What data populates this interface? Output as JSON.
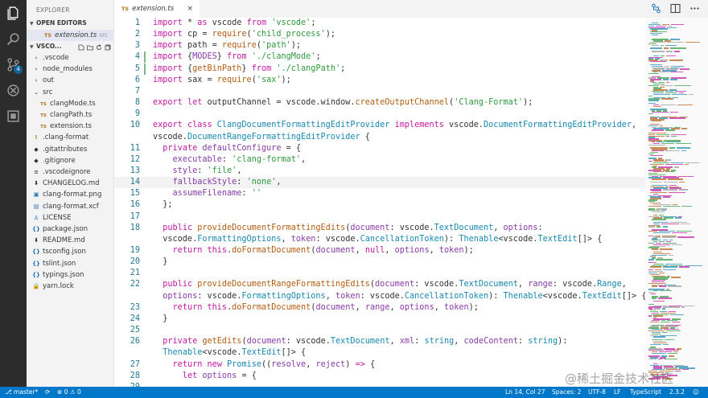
{
  "sidebar": {
    "title": "EXPLORER",
    "open_editors_label": "OPEN EDITORS",
    "open_editor": {
      "badge": "TS",
      "name": "extension.ts",
      "path": "src"
    },
    "project_label": "VSCO...",
    "tree": [
      {
        "label": ".vscode",
        "kind": "folder-closed",
        "indent": 1
      },
      {
        "label": "node_modules",
        "kind": "folder-closed",
        "indent": 1
      },
      {
        "label": "out",
        "kind": "folder-closed",
        "indent": 1
      },
      {
        "label": "src",
        "kind": "folder-open",
        "indent": 1
      },
      {
        "label": "clangMode.ts",
        "kind": "ts",
        "indent": 2
      },
      {
        "label": "clangPath.ts",
        "kind": "ts",
        "indent": 2
      },
      {
        "label": "extension.ts",
        "kind": "ts",
        "indent": 2
      },
      {
        "label": ".clang-format",
        "kind": "excl",
        "indent": 1
      },
      {
        "label": ".gitattributes",
        "kind": "git",
        "indent": 1
      },
      {
        "label": ".gitignore",
        "kind": "git",
        "indent": 1
      },
      {
        "label": ".vscodeignore",
        "kind": "lines",
        "indent": 1
      },
      {
        "label": "CHANGELOG.md",
        "kind": "down",
        "indent": 1
      },
      {
        "label": "clang-format.png",
        "kind": "img",
        "indent": 1
      },
      {
        "label": "clang-format.xcf",
        "kind": "file",
        "indent": 1
      },
      {
        "label": "LICENSE",
        "kind": "license",
        "indent": 1
      },
      {
        "label": "package.json",
        "kind": "json",
        "indent": 1
      },
      {
        "label": "README.md",
        "kind": "down",
        "indent": 1
      },
      {
        "label": "tsconfig.json",
        "kind": "json",
        "indent": 1
      },
      {
        "label": "tslint.json",
        "kind": "json",
        "indent": 1
      },
      {
        "label": "typings.json",
        "kind": "json",
        "indent": 1
      },
      {
        "label": "yarn.lock",
        "kind": "lock",
        "indent": 1
      }
    ]
  },
  "activity": {
    "scm_badge": "4"
  },
  "tab": {
    "badge": "TS",
    "name": "extension.ts",
    "close": "×"
  },
  "editor": {
    "current_line": 14,
    "lines": [
      {
        "n": "1",
        "mod": false,
        "tokens": [
          [
            "k",
            "import "
          ],
          [
            "m",
            "* "
          ],
          [
            "k",
            "as "
          ],
          [
            "m",
            "vscode "
          ],
          [
            "k",
            "from "
          ],
          [
            "s",
            "'vscode'"
          ],
          [
            "m",
            ";"
          ]
        ]
      },
      {
        "n": "2",
        "mod": false,
        "tokens": [
          [
            "k",
            "import "
          ],
          [
            "m",
            "cp = "
          ],
          [
            "f",
            "require"
          ],
          [
            "m",
            "("
          ],
          [
            "s",
            "'child_process'"
          ],
          [
            "m",
            ");"
          ]
        ]
      },
      {
        "n": "3",
        "mod": false,
        "tokens": [
          [
            "k",
            "import "
          ],
          [
            "m",
            "path = "
          ],
          [
            "f",
            "require"
          ],
          [
            "m",
            "("
          ],
          [
            "s",
            "'path'"
          ],
          [
            "m",
            ");"
          ]
        ]
      },
      {
        "n": "4",
        "mod": true,
        "tokens": [
          [
            "k",
            "import "
          ],
          [
            "m",
            "{"
          ],
          [
            "p",
            "MODES"
          ],
          [
            "m",
            "} "
          ],
          [
            "k",
            "from "
          ],
          [
            "s",
            "'./clangMode'"
          ],
          [
            "m",
            ";"
          ]
        ]
      },
      {
        "n": "5",
        "mod": true,
        "tokens": [
          [
            "k",
            "import "
          ],
          [
            "m",
            "{"
          ],
          [
            "f",
            "getBinPath"
          ],
          [
            "m",
            "} "
          ],
          [
            "k",
            "from "
          ],
          [
            "s",
            "'./clangPath'"
          ],
          [
            "m",
            ";"
          ]
        ]
      },
      {
        "n": "6",
        "mod": false,
        "tokens": [
          [
            "k",
            "import "
          ],
          [
            "m",
            "sax = "
          ],
          [
            "f",
            "require"
          ],
          [
            "m",
            "("
          ],
          [
            "s",
            "'sax'"
          ],
          [
            "m",
            ");"
          ]
        ]
      },
      {
        "n": "7",
        "mod": false,
        "tokens": []
      },
      {
        "n": "8",
        "mod": false,
        "tokens": [
          [
            "k",
            "export "
          ],
          [
            "k",
            "let "
          ],
          [
            "m",
            "outputChannel = vscode.window."
          ],
          [
            "f",
            "createOutputChannel"
          ],
          [
            "m",
            "("
          ],
          [
            "s",
            "'Clang-Format'"
          ],
          [
            "m",
            ");"
          ]
        ]
      },
      {
        "n": "9",
        "mod": false,
        "tokens": []
      },
      {
        "n": "10",
        "mod": false,
        "tokens": [
          [
            "k",
            "export "
          ],
          [
            "k",
            "class "
          ],
          [
            "t",
            "ClangDocumentFormattingEditProvider "
          ],
          [
            "k",
            "implements "
          ],
          [
            "m",
            "vscode."
          ],
          [
            "t",
            "DocumentFormattingEditProvider"
          ],
          [
            "m",
            ","
          ]
        ]
      },
      {
        "n": "",
        "mod": false,
        "tokens": [
          [
            "m",
            "vscode."
          ],
          [
            "t",
            "DocumentRangeFormattingEditProvider "
          ],
          [
            "m",
            "{"
          ]
        ]
      },
      {
        "n": "11",
        "mod": false,
        "tokens": [
          [
            "m",
            "  "
          ],
          [
            "k",
            "private "
          ],
          [
            "p",
            "defaultConfigure "
          ],
          [
            "m",
            "= {"
          ]
        ]
      },
      {
        "n": "12",
        "mod": false,
        "tokens": [
          [
            "m",
            "    "
          ],
          [
            "p",
            "executable"
          ],
          [
            "m",
            ": "
          ],
          [
            "s",
            "'clang-format'"
          ],
          [
            "m",
            ","
          ]
        ]
      },
      {
        "n": "13",
        "mod": false,
        "tokens": [
          [
            "m",
            "    "
          ],
          [
            "p",
            "style"
          ],
          [
            "m",
            ": "
          ],
          [
            "s",
            "'file'"
          ],
          [
            "m",
            ","
          ]
        ]
      },
      {
        "n": "14",
        "mod": false,
        "tokens": [
          [
            "m",
            "    "
          ],
          [
            "p",
            "fallbackStyle"
          ],
          [
            "m",
            ": "
          ],
          [
            "s",
            "'none'"
          ],
          [
            "m",
            ","
          ]
        ]
      },
      {
        "n": "15",
        "mod": false,
        "tokens": [
          [
            "m",
            "    "
          ],
          [
            "p",
            "assumeFilename"
          ],
          [
            "m",
            ": "
          ],
          [
            "s",
            "''"
          ]
        ]
      },
      {
        "n": "16",
        "mod": false,
        "tokens": [
          [
            "m",
            "  };"
          ]
        ]
      },
      {
        "n": "17",
        "mod": false,
        "tokens": []
      },
      {
        "n": "18",
        "mod": false,
        "tokens": [
          [
            "m",
            "  "
          ],
          [
            "k",
            "public "
          ],
          [
            "f",
            "provideDocumentFormattingEdits"
          ],
          [
            "m",
            "("
          ],
          [
            "p",
            "document"
          ],
          [
            "m",
            ": vscode."
          ],
          [
            "t",
            "TextDocument"
          ],
          [
            "m",
            ", "
          ],
          [
            "p",
            "options"
          ],
          [
            "m",
            ":"
          ]
        ]
      },
      {
        "n": "",
        "mod": false,
        "tokens": [
          [
            "m",
            "  vscode."
          ],
          [
            "t",
            "FormattingOptions"
          ],
          [
            "m",
            ", "
          ],
          [
            "p",
            "token"
          ],
          [
            "m",
            ": vscode."
          ],
          [
            "t",
            "CancellationToken"
          ],
          [
            "m",
            "): "
          ],
          [
            "t",
            "Thenable"
          ],
          [
            "m",
            "<vscode."
          ],
          [
            "t",
            "TextEdit"
          ],
          [
            "m",
            "[]> {"
          ]
        ]
      },
      {
        "n": "19",
        "mod": false,
        "tokens": [
          [
            "m",
            "    "
          ],
          [
            "k",
            "return "
          ],
          [
            "k",
            "this"
          ],
          [
            "m",
            "."
          ],
          [
            "f",
            "doFormatDocument"
          ],
          [
            "m",
            "("
          ],
          [
            "p",
            "document"
          ],
          [
            "m",
            ", "
          ],
          [
            "k",
            "null"
          ],
          [
            "m",
            ", "
          ],
          [
            "p",
            "options"
          ],
          [
            "m",
            ", "
          ],
          [
            "p",
            "token"
          ],
          [
            "m",
            ");"
          ]
        ]
      },
      {
        "n": "20",
        "mod": false,
        "tokens": [
          [
            "m",
            "  }"
          ]
        ]
      },
      {
        "n": "21",
        "mod": false,
        "tokens": []
      },
      {
        "n": "22",
        "mod": false,
        "tokens": [
          [
            "m",
            "  "
          ],
          [
            "k",
            "public "
          ],
          [
            "f",
            "provideDocumentRangeFormattingEdits"
          ],
          [
            "m",
            "("
          ],
          [
            "p",
            "document"
          ],
          [
            "m",
            ": vscode."
          ],
          [
            "t",
            "TextDocument"
          ],
          [
            "m",
            ", "
          ],
          [
            "p",
            "range"
          ],
          [
            "m",
            ": vscode."
          ],
          [
            "t",
            "Range"
          ],
          [
            "m",
            ","
          ]
        ]
      },
      {
        "n": "",
        "mod": false,
        "tokens": [
          [
            "m",
            "  "
          ],
          [
            "p",
            "options"
          ],
          [
            "m",
            ": vscode."
          ],
          [
            "t",
            "FormattingOptions"
          ],
          [
            "m",
            ", "
          ],
          [
            "p",
            "token"
          ],
          [
            "m",
            ": vscode."
          ],
          [
            "t",
            "CancellationToken"
          ],
          [
            "m",
            "): "
          ],
          [
            "t",
            "Thenable"
          ],
          [
            "m",
            "<vscode."
          ],
          [
            "t",
            "TextEdit"
          ],
          [
            "m",
            "[]> {"
          ]
        ]
      },
      {
        "n": "23",
        "mod": false,
        "tokens": [
          [
            "m",
            "    "
          ],
          [
            "k",
            "return "
          ],
          [
            "k",
            "this"
          ],
          [
            "m",
            "."
          ],
          [
            "f",
            "doFormatDocument"
          ],
          [
            "m",
            "("
          ],
          [
            "p",
            "document"
          ],
          [
            "m",
            ", "
          ],
          [
            "p",
            "range"
          ],
          [
            "m",
            ", "
          ],
          [
            "p",
            "options"
          ],
          [
            "m",
            ", "
          ],
          [
            "p",
            "token"
          ],
          [
            "m",
            ");"
          ]
        ]
      },
      {
        "n": "24",
        "mod": false,
        "tokens": [
          [
            "m",
            "  }"
          ]
        ]
      },
      {
        "n": "25",
        "mod": false,
        "tokens": []
      },
      {
        "n": "26",
        "mod": false,
        "tokens": [
          [
            "m",
            "  "
          ],
          [
            "k",
            "private "
          ],
          [
            "f",
            "getEdits"
          ],
          [
            "m",
            "("
          ],
          [
            "p",
            "document"
          ],
          [
            "m",
            ": vscode."
          ],
          [
            "t",
            "TextDocument"
          ],
          [
            "m",
            ", "
          ],
          [
            "p",
            "xml"
          ],
          [
            "m",
            ": "
          ],
          [
            "t",
            "string"
          ],
          [
            "m",
            ", "
          ],
          [
            "p",
            "codeContent"
          ],
          [
            "m",
            ": "
          ],
          [
            "t",
            "string"
          ],
          [
            "m",
            "):"
          ]
        ]
      },
      {
        "n": "",
        "mod": false,
        "tokens": [
          [
            "m",
            "  "
          ],
          [
            "t",
            "Thenable"
          ],
          [
            "m",
            "<vscode."
          ],
          [
            "t",
            "TextEdit"
          ],
          [
            "m",
            "[]> {"
          ]
        ]
      },
      {
        "n": "27",
        "mod": false,
        "tokens": [
          [
            "m",
            "    "
          ],
          [
            "k",
            "return "
          ],
          [
            "k",
            "new "
          ],
          [
            "t",
            "Promise"
          ],
          [
            "m",
            "(("
          ],
          [
            "p",
            "resolve"
          ],
          [
            "m",
            ", "
          ],
          [
            "p",
            "reject"
          ],
          [
            "m",
            ") "
          ],
          [
            "k",
            "=> "
          ],
          [
            "m",
            "{"
          ]
        ]
      },
      {
        "n": "28",
        "mod": false,
        "tokens": [
          [
            "m",
            "      "
          ],
          [
            "k",
            "let "
          ],
          [
            "p",
            "options "
          ],
          [
            "m",
            "= {"
          ]
        ]
      },
      {
        "n": "29",
        "mod": false,
        "tokens": []
      }
    ]
  },
  "status": {
    "branch": "master*",
    "errors": "0",
    "warnings": "0",
    "position": "Ln 14, Col 27",
    "spaces": "Spaces: 2",
    "encoding": "UTF-8",
    "eol": "LF",
    "language": "TypeScript",
    "version": "2.3.2",
    "smiley": "☺"
  },
  "watermark": "@稀土掘金技术社区",
  "colors": {
    "activity_bg": "#2c2c2c",
    "status_bg": "#0077c8",
    "sidebar_bg": "#f3f3f3",
    "badge": "#0e639c"
  }
}
